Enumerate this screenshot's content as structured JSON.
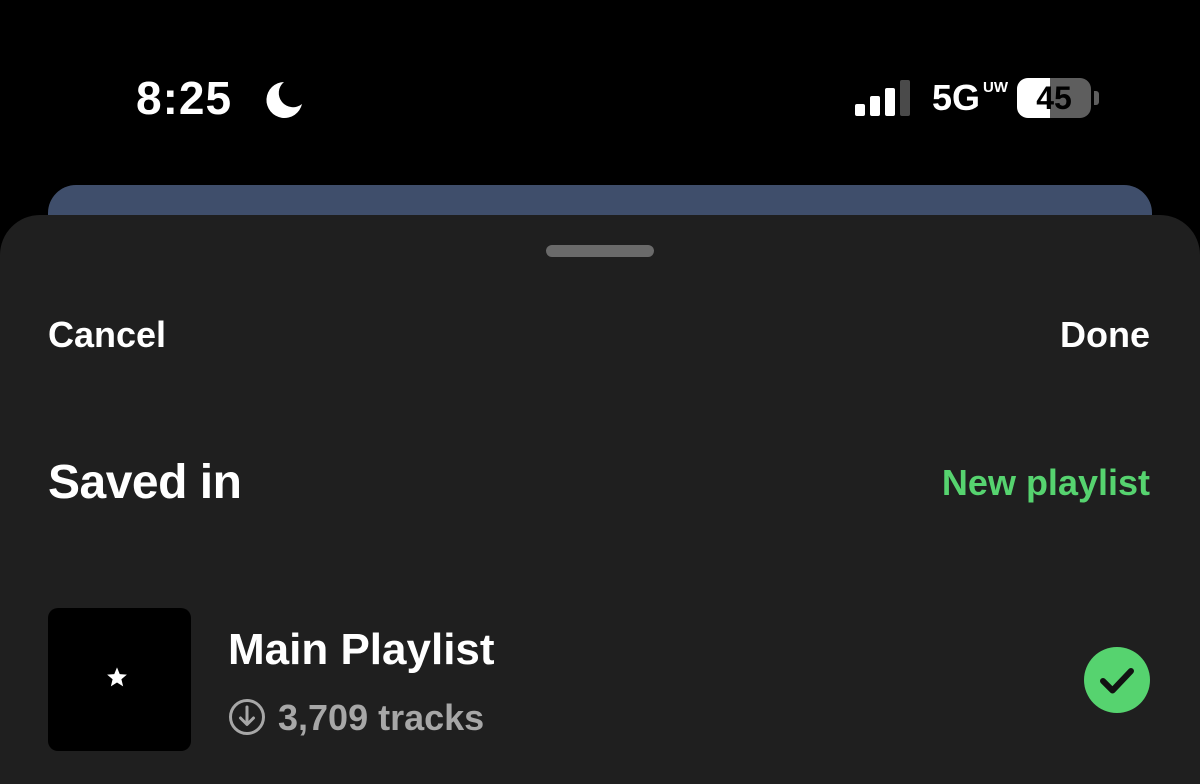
{
  "status_bar": {
    "time": "8:25",
    "focus_icon": "moon-icon",
    "signal_icon": "cellular-signal-icon",
    "signal_bars_active": 3,
    "signal_bars_total": 4,
    "network": "5G",
    "network_sub": "UW",
    "battery_percent": "45",
    "battery_level": 0.45
  },
  "sheet": {
    "cancel_label": "Cancel",
    "done_label": "Done",
    "section_title": "Saved in",
    "new_playlist_label": "New playlist",
    "playlists": [
      {
        "name": "Main Playlist",
        "track_count": "3,709 tracks",
        "art_icon": "star-icon",
        "downloaded_icon": "download-icon",
        "saved": true,
        "status_icon": "check-icon"
      }
    ]
  },
  "colors": {
    "background": "#000000",
    "sheet": "#1f1f1f",
    "background_card": "#3f4e6b",
    "accent_green": "#56d36f",
    "secondary_text": "#a7a7a7",
    "primary_text": "#ffffff"
  }
}
